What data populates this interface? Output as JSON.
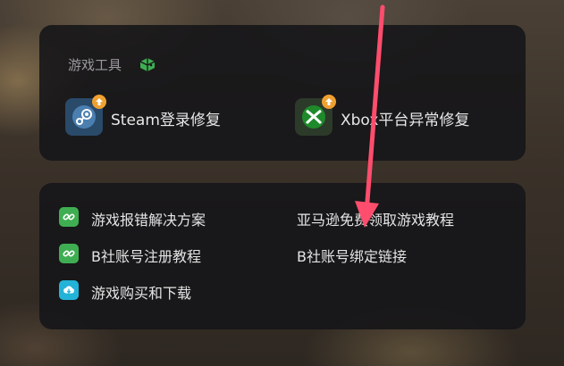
{
  "tools_section": {
    "title": "游戏工具",
    "title_icon": "game-controller-icon",
    "items": [
      {
        "label": "Steam登录修复",
        "icon": "steam-icon",
        "badge_icon": "upload-arrow-icon"
      },
      {
        "label": "Xbox平台异常修复",
        "icon": "xbox-icon",
        "badge_icon": "upload-arrow-icon"
      }
    ]
  },
  "links_section": {
    "items": [
      {
        "label": "游戏报错解决方案",
        "icon": "link-icon"
      },
      {
        "label": "亚马逊免费领取游戏教程",
        "icon": ""
      },
      {
        "label": "B社账号注册教程",
        "icon": "link-icon"
      },
      {
        "label": "B社账号绑定链接",
        "icon": ""
      },
      {
        "label": "游戏购买和下载",
        "icon": "cloud-download-icon"
      }
    ]
  },
  "colors": {
    "panel_bg": "#141418",
    "accent_green": "#3fae52",
    "accent_teal": "#23b3d8",
    "badge_orange": "#f0a030",
    "arrow_red": "#ff4d6d"
  }
}
